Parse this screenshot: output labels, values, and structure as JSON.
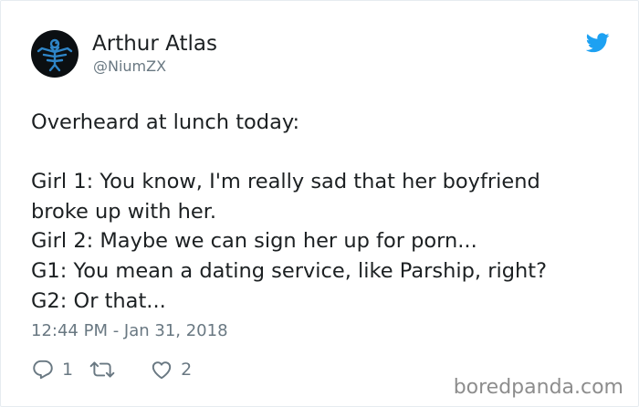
{
  "author": {
    "display_name": "Arthur Atlas",
    "handle": "@NiumZX",
    "avatar_icon": "blue-bird-emblem-icon"
  },
  "brand": {
    "icon": "twitter-bird-icon",
    "color": "#1da1f2"
  },
  "tweet": {
    "lines": [
      "Overheard at lunch today:",
      "",
      "Girl 1: You know, I'm really sad that her boyfriend",
      "broke up with her.",
      "Girl 2: Maybe we can sign her up for porn...",
      "G1: You mean a dating service, like Parship, right?",
      "G2: Or that..."
    ],
    "timestamp": "12:44 PM - Jan 31, 2018"
  },
  "actions": {
    "reply": {
      "icon": "reply-icon",
      "count": "1"
    },
    "retweet": {
      "icon": "retweet-icon",
      "count": ""
    },
    "like": {
      "icon": "heart-icon",
      "count": "2"
    }
  },
  "watermark": "boredpanda.com",
  "colors": {
    "text": "#1c2022",
    "muted": "#697882",
    "border": "#e6ecf0",
    "watermark": "#8d8d8d"
  }
}
